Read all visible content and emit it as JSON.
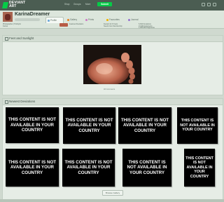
{
  "brand": {
    "line1": "DEVIANT",
    "line2": "ART"
  },
  "top_nav": {
    "shop": "Shop",
    "groups": "Groups",
    "more": "More",
    "submit": "Submit"
  },
  "profile": {
    "username": "KarinaDreamer"
  },
  "tabs": [
    {
      "label": "Profile",
      "icon": "profile-icon",
      "color": "#6fa9d8"
    },
    {
      "label": "Gallery",
      "icon": "gallery-icon",
      "color": "#e88a2e"
    },
    {
      "label": "Prints",
      "icon": "prints-icon",
      "color": "#d07fc7"
    },
    {
      "label": "Favourites",
      "icon": "star-icon",
      "color": "#f2b705"
    },
    {
      "label": "Journal",
      "icon": "journal-icon",
      "color": "#9a7bd0"
    }
  ],
  "subinfo": {
    "col1": [
      "Photographer | Hobbyist",
      "Karina"
    ],
    "col2": [
      "Featured Deviation"
    ],
    "col3": [
      "Deviant for 8 Years",
      "Needs Core Membership"
    ],
    "col4": [
      "6,394 Deviations",
      "13,460 Comments",
      "1,296,960 Pageviews"
    ]
  },
  "featured": {
    "title": "Feet and Sunlight",
    "caption": "46 Comments"
  },
  "recent": {
    "title": "Newest Deviations",
    "blocked_text": "THIS CONTENT IS NOT AVAILABLE IN YOUR COUNTRY",
    "browse": "Browse Gallery"
  },
  "colors": {
    "accent": "#05cc47",
    "topbar": "#4b5d52",
    "page_bg": "#cfd9cf",
    "panel_bg": "#e6ede6"
  }
}
